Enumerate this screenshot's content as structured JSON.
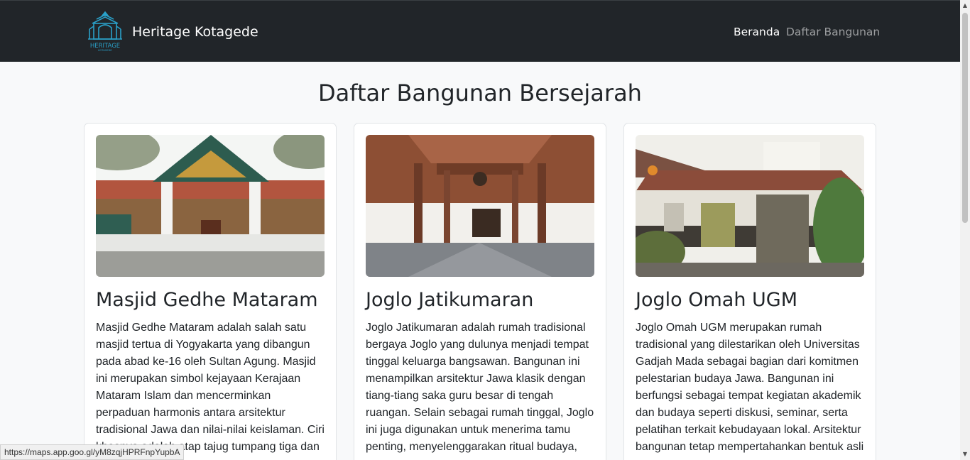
{
  "navbar": {
    "brand_name": "Heritage Kotagede",
    "logo_text": "HERITAGE",
    "logo_subtext": "KOTAGEDE",
    "links": [
      {
        "label": "Beranda",
        "active": true
      },
      {
        "label": "Daftar Bangunan",
        "active": false
      }
    ]
  },
  "main": {
    "title": "Daftar Bangunan Bersejarah",
    "cards": [
      {
        "title": "Masjid Gedhe Mataram",
        "text": "Masjid Gedhe Mataram adalah salah satu masjid tertua di Yogyakarta yang dibangun pada abad ke-16 oleh Sultan Agung. Masjid ini merupakan simbol kejayaan Kerajaan Mataram Islam dan mencerminkan perpaduan harmonis antara arsitektur tradisional Jawa dan nilai-nilai keislaman. Ciri khasnya adalah atap tajug tumpang tiga dan"
      },
      {
        "title": "Joglo Jatikumaran",
        "text": "Joglo Jatikumaran adalah rumah tradisional bergaya Joglo yang dulunya menjadi tempat tinggal keluarga bangsawan. Bangunan ini menampilkan arsitektur Jawa klasik dengan tiang-tiang saka guru besar di tengah ruangan. Selain sebagai rumah tinggal, Joglo ini juga digunakan untuk menerima tamu penting, menyelenggarakan ritual budaya,"
      },
      {
        "title": "Joglo Omah UGM",
        "text": "Joglo Omah UGM merupakan rumah tradisional yang dilestarikan oleh Universitas Gadjah Mada sebagai bagian dari komitmen pelestarian budaya Jawa. Bangunan ini berfungsi sebagai tempat kegiatan akademik dan budaya seperti diskusi, seminar, serta pelatihan terkait kebudayaan lokal. Arsitektur bangunan tetap mempertahankan bentuk asli"
      }
    ]
  },
  "status_bar": {
    "url": "https://maps.app.goo.gl/yM8zqjHPRFnpYupbA"
  },
  "colors": {
    "navbar_bg": "#212529",
    "page_bg": "#f8f9fa",
    "logo_accent": "#2aa0c8"
  }
}
